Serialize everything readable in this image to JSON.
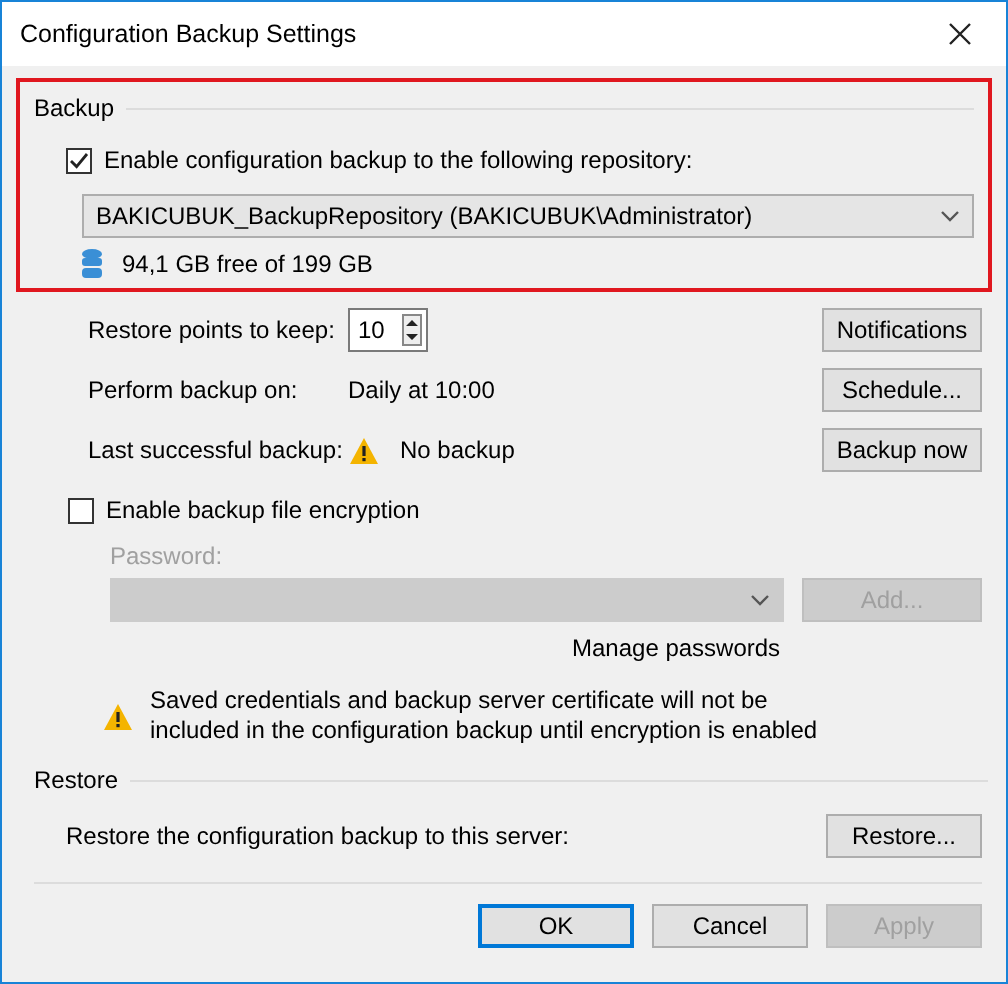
{
  "window": {
    "title": "Configuration Backup Settings"
  },
  "backup": {
    "label": "Backup",
    "highlighted": true,
    "enable": {
      "label": "Enable configuration backup to the following repository:",
      "checked": true
    },
    "repository": {
      "value": "BAKICUBUK_BackupRepository (BAKICUBUK\\Administrator)"
    },
    "storage": "94,1 GB free of 199 GB",
    "rows": [
      {
        "kind": "spinner",
        "label": "Restore points to keep:",
        "value": "10",
        "button": "Notifications"
      },
      {
        "kind": "text",
        "label": "Perform backup on:",
        "value": "Daily at 10:00",
        "button": "Schedule..."
      },
      {
        "kind": "warning",
        "label": "Last successful backup:",
        "value": "No backup",
        "button": "Backup now"
      }
    ]
  },
  "encryption": {
    "label": "Enable backup file encryption",
    "checked": false,
    "password_label": "Password:",
    "add_button": "Add...",
    "manage_link": "Manage passwords",
    "warning": "Saved credentials and backup server certificate will not be included in the configuration backup until encryption is enabled"
  },
  "restore": {
    "label": "Restore",
    "text": "Restore the configuration backup to this server:",
    "button": "Restore..."
  },
  "buttons": [
    {
      "label": "OK",
      "default": true,
      "disabled": false
    },
    {
      "label": "Cancel",
      "default": false,
      "disabled": false
    },
    {
      "label": "Apply",
      "default": false,
      "disabled": true
    }
  ]
}
